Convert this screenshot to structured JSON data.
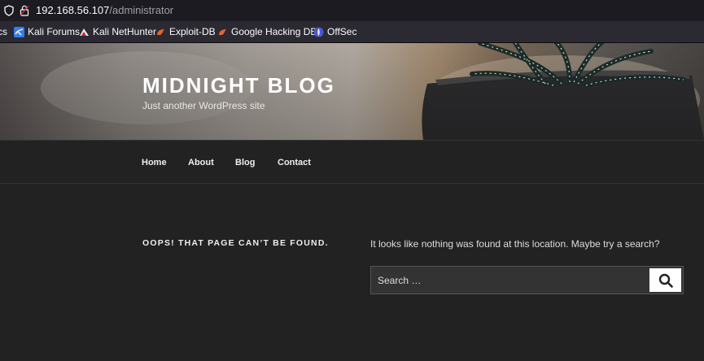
{
  "browser": {
    "url_host": "192.168.56.107",
    "url_path": "/administrator"
  },
  "bookmarks": [
    {
      "label": "cs",
      "icon": "kali-docs-icon"
    },
    {
      "label": "Kali Forums",
      "icon": "kali-forums-icon"
    },
    {
      "label": "Kali NetHunter",
      "icon": "kali-nethunter-icon"
    },
    {
      "label": "Exploit-DB",
      "icon": "exploit-db-icon"
    },
    {
      "label": "Google Hacking DB",
      "icon": "ghdb-icon"
    },
    {
      "label": "OffSec",
      "icon": "offsec-icon"
    }
  ],
  "site": {
    "title": "MIDNIGHT BLOG",
    "description": "Just another WordPress site"
  },
  "nav": {
    "items": [
      "Home",
      "About",
      "Blog",
      "Contact"
    ]
  },
  "page": {
    "error_title": "OOPS! THAT PAGE CAN’T BE FOUND.",
    "error_message": "It looks like nothing was found at this location. Maybe try a search?"
  },
  "search": {
    "placeholder": "Search …"
  },
  "colors": {
    "background": "#222222",
    "text": "#eeeeee",
    "browser_bar": "#1c1b22",
    "bookmarks_bar": "#2b2a33"
  }
}
